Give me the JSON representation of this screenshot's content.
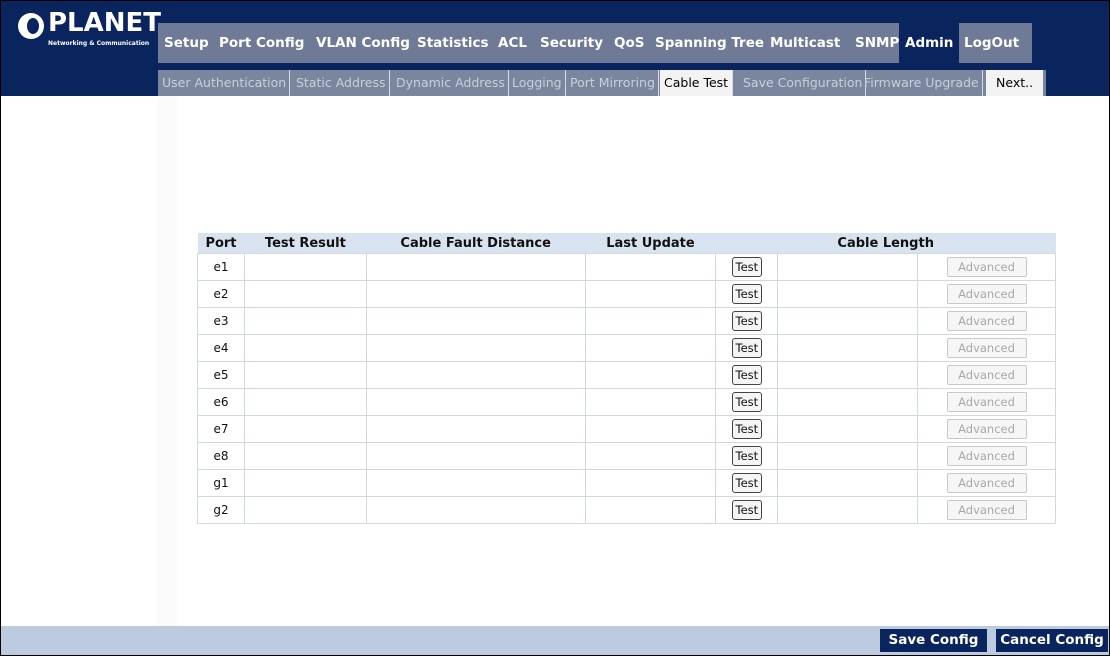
{
  "brand": {
    "name": "PLANET",
    "tagline": "Networking & Communication"
  },
  "main_nav": [
    "Setup",
    "Port Config",
    "VLAN Config",
    "Statistics",
    "ACL",
    "Security",
    "QoS",
    "Spanning Tree",
    "Multicast",
    "SNMP",
    "Admin",
    "LogOut"
  ],
  "main_nav_active": "Admin",
  "sub_nav": [
    "User Authentication",
    "Static Address",
    "Dynamic Address",
    "Logging",
    "Port Mirroring",
    "Cable Test",
    "Save Configuration",
    "Firmware Upgrade",
    "Next.."
  ],
  "sub_nav_active": "Cable Test",
  "table": {
    "headers": [
      "Port",
      "Test Result",
      "Cable Fault Distance",
      "Last Update",
      "Cable Length"
    ],
    "test_label": "Test",
    "advanced_label": "Advanced",
    "rows": [
      "e1",
      "e2",
      "e3",
      "e4",
      "e5",
      "e6",
      "e7",
      "e8",
      "g1",
      "g2"
    ]
  },
  "footer": {
    "save": "Save Config",
    "cancel": "Cancel Config"
  },
  "colors": {
    "navy": "#0a245e",
    "nav_gray": "#6f7b96",
    "header_row": "#d9e2ef",
    "footer_bar": "#bccbe0"
  }
}
